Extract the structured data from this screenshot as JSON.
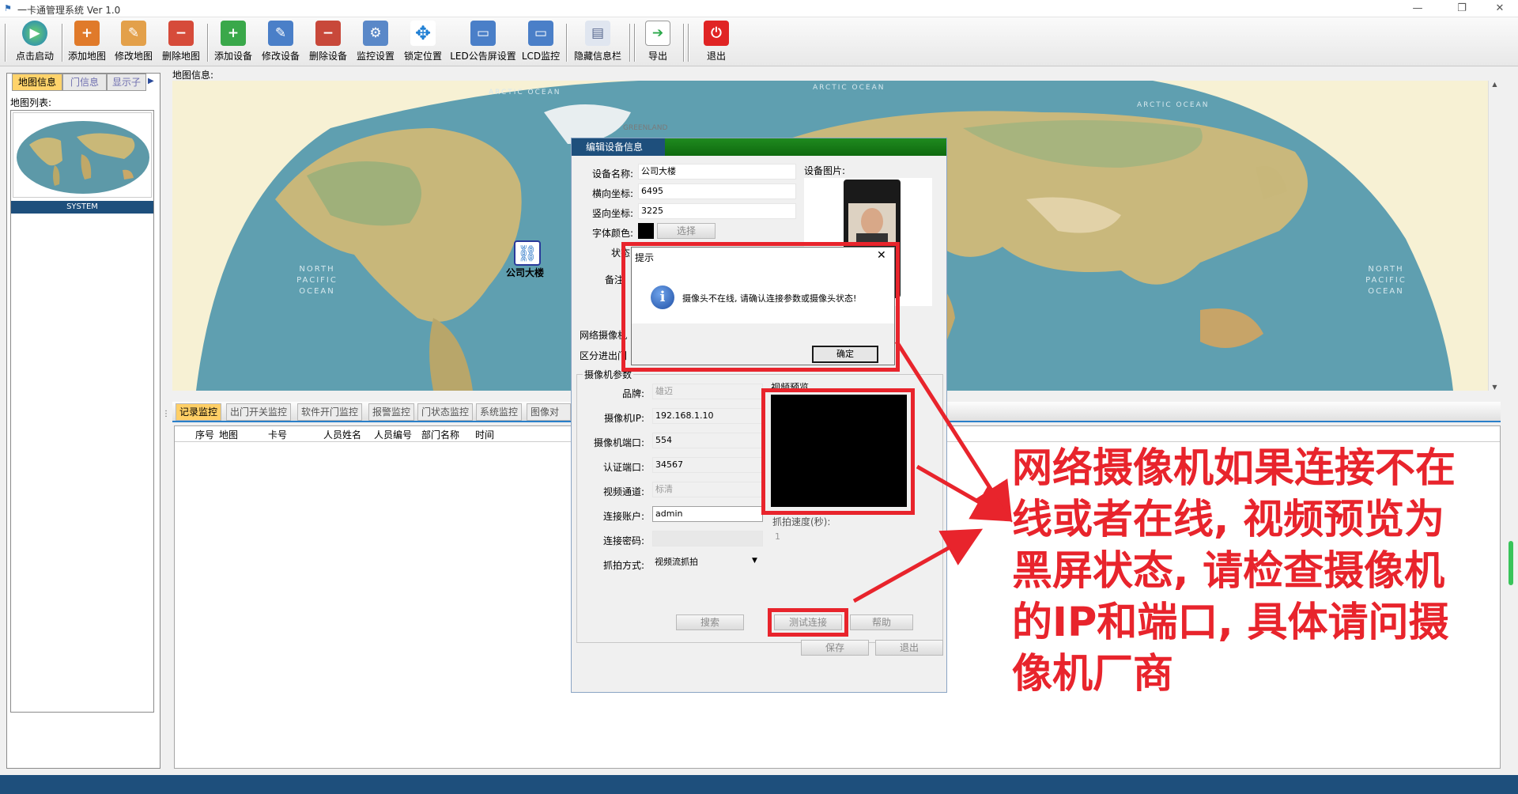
{
  "window": {
    "title": "一卡通管理系统 Ver 1.0",
    "minimize": "—",
    "restore": "❐",
    "close": "✕"
  },
  "toolbar": {
    "items": [
      {
        "label": "点击启动",
        "icon": "play-icon"
      },
      {
        "label": "添加地图",
        "icon": "add-map-icon"
      },
      {
        "label": "修改地图",
        "icon": "edit-map-icon"
      },
      {
        "label": "删除地图",
        "icon": "delete-map-icon"
      },
      {
        "label": "添加设备",
        "icon": "add-device-icon"
      },
      {
        "label": "修改设备",
        "icon": "edit-device-icon"
      },
      {
        "label": "删除设备",
        "icon": "delete-device-icon"
      },
      {
        "label": "监控设置",
        "icon": "monitor-settings-icon"
      },
      {
        "label": "锁定位置",
        "icon": "lock-position-icon"
      },
      {
        "label": "LED公告屏设置",
        "icon": "led-screen-icon"
      },
      {
        "label": "LCD监控",
        "icon": "lcd-monitor-icon"
      },
      {
        "label": "隐藏信息栏",
        "icon": "hide-panel-icon"
      },
      {
        "label": "导出",
        "icon": "export-icon"
      },
      {
        "label": "退出",
        "icon": "power-icon"
      }
    ]
  },
  "left": {
    "tabs": [
      "地图信息",
      "门信息",
      "显示子"
    ],
    "list_label": "地图列表:",
    "map_name": "SYSTEM"
  },
  "map": {
    "label": "地图信息:",
    "device_name": "公司大楼",
    "labels": [
      "ARCTIC OCEAN",
      "ARCTIC OCEAN",
      "ARCTIC OCEAN",
      "GREENLAND",
      "NORTH PACIFIC OCEAN",
      "NORTH PACIFIC OCEAN"
    ]
  },
  "edit": {
    "title": "编辑设备信息",
    "name_label": "设备名称:",
    "name_value": "公司大楼",
    "x_label": "横向坐标:",
    "x_value": "6495",
    "y_label": "竖向坐标:",
    "y_value": "3225",
    "font_color_label": "字体颜色:",
    "choose": "选择",
    "status_label": "状态:",
    "note_label": "备注",
    "photo_label": "设备图片:",
    "net_cam_label": "网络摄像机",
    "zone_label": "区分进出门",
    "cam_group": "摄像机参数",
    "brand_label": "品牌:",
    "brand_value": "雄迈",
    "ip_label": "摄像机IP:",
    "ip_value": "192.168.1.10",
    "port_label": "摄像机端口:",
    "port_value": "554",
    "auth_label": "认证端口:",
    "auth_value": "34567",
    "channel_label": "视频通道:",
    "channel_value": "标清",
    "account_label": "连接账户:",
    "account_value": "admin",
    "password_label": "连接密码:",
    "password_value": "",
    "capture_label": "抓拍方式:",
    "capture_value": "视频流抓拍",
    "preview_label": "视频预览",
    "interval_label": "抓拍速度(秒):",
    "interval_value": "1",
    "search": "搜索",
    "test": "测试连接",
    "help": "帮助",
    "save": "保存",
    "exit": "退出"
  },
  "dialog": {
    "title": "提示",
    "message": "摄像头不在线, 请确认连接参数或摄像头状态!",
    "ok": "确定",
    "close": "✕"
  },
  "bottom": {
    "tabs": [
      "记录监控",
      "出门开关监控",
      "软件开门监控",
      "报警监控",
      "门状态监控",
      "系统监控",
      "图像对比"
    ],
    "columns": [
      "序号",
      "地图",
      "卡号",
      "人员姓名",
      "人员编号",
      "部门名称",
      "时间"
    ]
  },
  "annotation": {
    "lines": [
      "网络摄像机如果连接不在",
      "线或者在线, 视频预览为",
      "黑屏状态, 请检查摄像机",
      "的IP和端口, 具体请问摄",
      "像机厂商"
    ]
  },
  "colors": {
    "accent": "#1e4f7c",
    "highlight_tab": "#ffcf66",
    "annotation_red": "#e8242c",
    "title_green": "#1e8a1e"
  }
}
